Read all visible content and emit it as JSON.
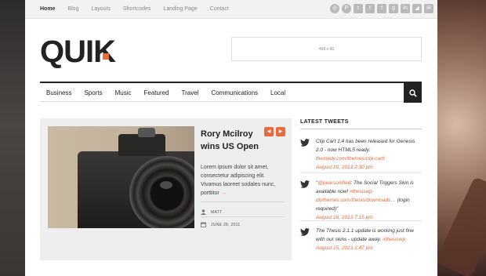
{
  "topnav": [
    "Home",
    "Blog",
    "Layouts",
    "Shortcodes",
    "Landing Page",
    "Contact"
  ],
  "social_icons": [
    "dribbble-icon",
    "pinterest-icon",
    "twitter-icon",
    "tumblr-icon",
    "facebook-icon",
    "googleplus-icon",
    "linkedin-icon",
    "rss-icon",
    "email-icon"
  ],
  "logo": {
    "text": "QUIK",
    "dot_color": "#e76b3c"
  },
  "ad": {
    "text": "468 x 60"
  },
  "mainnav": [
    "Business",
    "Sports",
    "Music",
    "Featured",
    "Travel",
    "Communications",
    "Local"
  ],
  "accent": "#e76b3c",
  "featured": {
    "title": "Rory Mcilroy wins US Open",
    "excerpt": "Lorem ipsum dolor sit amet, consectetur adipiscing elit. Vivamus laoreet sodales nunc, porttitor",
    "more": "→",
    "author": "MATT",
    "date": "JUNE 28, 2011"
  },
  "tweets": {
    "title": "LATEST TWEETS",
    "items": [
      {
        "text": "Clip Cart 1.4 has been released for Genesis 2.0 - now HTML5 ready:",
        "link": "themedy.com/themes/clip-cart/",
        "time": "August 20, 2013 2:30 pm"
      },
      {
        "prefix": "\"",
        "handle": "@pearsonified",
        "text": ": The Social Triggers Skin is available now! ",
        "tag": "#thesiswp",
        "link": "diythemes.com/thesis/downloads…",
        "suffix": " (login required)\"",
        "time": "August 18, 2013 7:15 pm"
      },
      {
        "text": "The Thesis 2.1.1 update is working just fine with our skins - update away. ",
        "tag": "#thesiswp",
        "time": "August 15, 2013 1:47 pm"
      }
    ]
  }
}
